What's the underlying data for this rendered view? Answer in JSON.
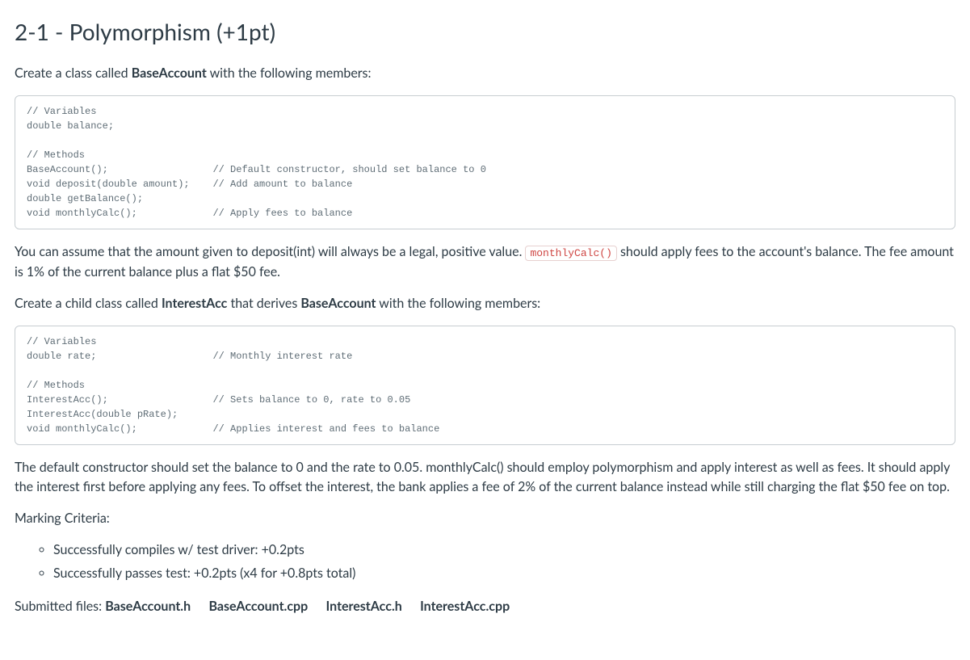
{
  "heading": "2-1 - Polymorphism (+1pt)",
  "intro_pre": "Create a class called ",
  "intro_bold": "BaseAccount",
  "intro_post": " with the following members:",
  "code1": "// Variables\ndouble balance;\n\n// Methods\nBaseAccount();                  // Default constructor, should set balance to 0\nvoid deposit(double amount);    // Add amount to balance\ndouble getBalance();\nvoid monthlyCalc();             // Apply fees to balance",
  "p2_a": "You can assume that the amount given to deposit(int) will always be a legal, positive value. ",
  "p2_code": "monthlyCalc()",
  "p2_b": " should apply fees to the account's balance. The fee amount is 1% of the current balance plus a flat $50 fee.",
  "p3_a": "Create a child class called ",
  "p3_bold1": "InterestAcc",
  "p3_b": " that derives ",
  "p3_bold2": "BaseAccount",
  "p3_c": " with the following members:",
  "code2": "// Variables\ndouble rate;                    // Monthly interest rate\n\n// Methods\nInterestAcc();                  // Sets balance to 0, rate to 0.05\nInterestAcc(double pRate);\nvoid monthlyCalc();             // Applies interest and fees to balance",
  "p4": "The default constructor should set the balance to 0 and the rate to 0.05. monthlyCalc() should employ polymorphism and apply interest as well as fees. It should apply the interest first before applying any fees. To offset the interest, the bank applies a fee of 2% of the current balance instead while still charging the flat $50 fee on top.",
  "criteria_label": "Marking Criteria:",
  "criteria": [
    "Successfully compiles w/ test driver: +0.2pts",
    "Successfully passes test: +0.2pts (x4 for +0.8pts total)"
  ],
  "submitted_label": "Submitted files: ",
  "submitted_files": [
    "BaseAccount.h",
    "BaseAccount.cpp",
    "InterestAcc.h",
    "InterestAcc.cpp"
  ]
}
